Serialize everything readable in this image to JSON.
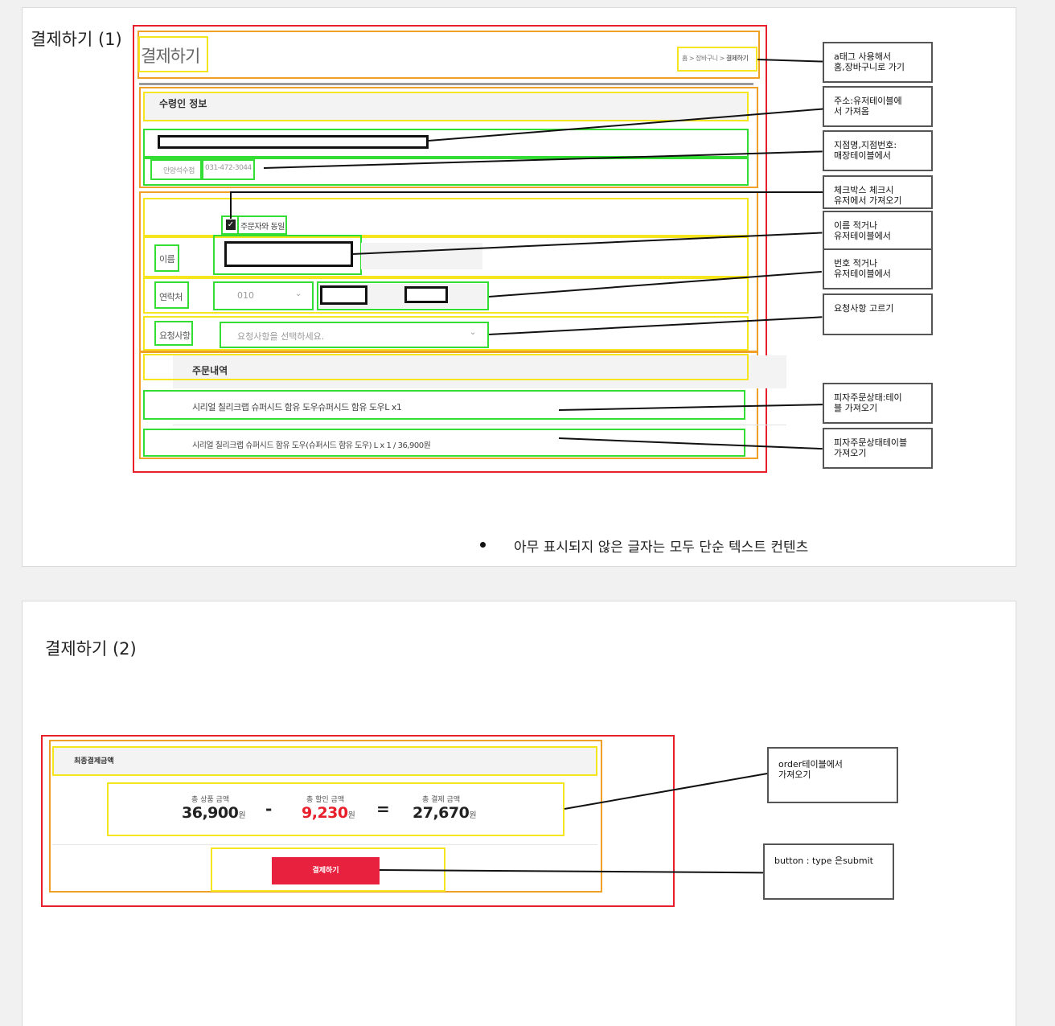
{
  "page1": {
    "title": "결제하기 (1)",
    "mock": {
      "heading": "결제하기",
      "breadcrumb": [
        "홈",
        "장바구니",
        "결제하기"
      ],
      "breadcrumb_sep": ">",
      "recipient_section": "수령인 정보",
      "store_name": "안양석수점",
      "store_phone": "031-472-3044",
      "same_as_orderer_label": "주문자와 동일",
      "name_label": "이름",
      "phone_label": "연락처",
      "phone_prefix": "010",
      "request_label": "요청사항",
      "request_placeholder": "요청사항을 선택하세요.",
      "order_section": "주문내역",
      "order_items": [
        "시리얼 칠리크랩 슈퍼시드 함유 도우슈퍼시드 함유 도우L x1",
        "시리얼 칠리크랩 슈퍼시드 함유 도우(슈퍼시드 함유 도우) L x 1 / 36,900원"
      ]
    },
    "notes": [
      "a태그 사용해서\n홈,장바구니로 가기",
      "주소:유저테이블에\n서 가져옴",
      "지점명,지점번호:\n매장테이블에서",
      "체크박스 체크시\n유저에서 가져오기",
      "이름 적거나\n유저테이블에서",
      "번호 적거나\n유저테이블에서",
      "요청사항 고르기",
      "피자주문상태:테이\n블 가져오기",
      "피자주문상태테이블\n가져오기"
    ],
    "bullet": "아무 표시되지 않은 글자는 모두 단순 텍스트 컨텐츠"
  },
  "page2": {
    "title": "결제하기 (2)",
    "mock": {
      "final_section": "최종결제금액",
      "total_label": "총 상품 금액",
      "total_value": "36,900",
      "discount_label": "총 할인 금액",
      "discount_value": "9,230",
      "pay_label": "총 결제 금액",
      "pay_value": "27,670",
      "won": "원",
      "minus": "-",
      "equals": "=",
      "submit_label": "결제하기"
    },
    "notes": [
      "order테이블에서\n가져오기",
      "button : type 은submit"
    ]
  },
  "colors": {
    "outer_frame": "#e8202b",
    "section_frame": "#f0a024",
    "block_frame": "#f5e51f",
    "element_frame": "#33dd33",
    "discount": "#e8202b",
    "submit_button": "#e8213f"
  }
}
